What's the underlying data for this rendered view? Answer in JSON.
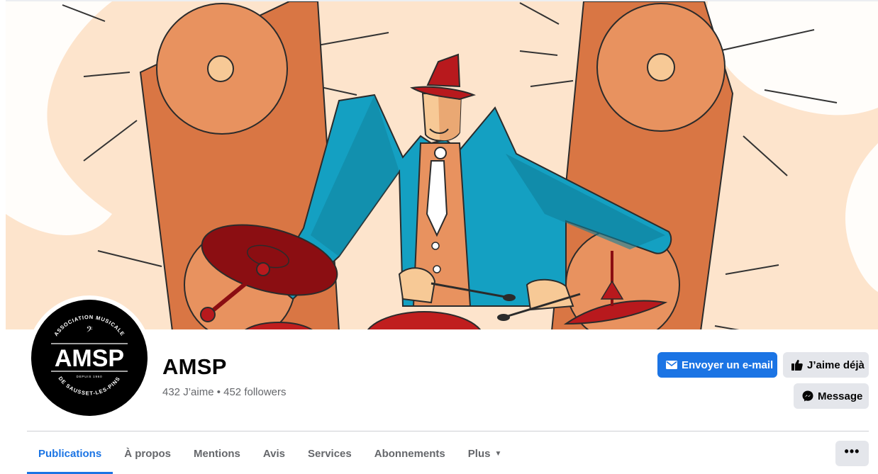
{
  "page": {
    "name": "AMSP",
    "stats": "432 J’aime • 452 followers",
    "avatar_text": {
      "arc_top": "ASSOCIATION MUSICALE",
      "center": "AMSP",
      "small": "DEPUIS 1960",
      "arc_bottom": "DE SAUSSET-LES-PINS"
    }
  },
  "actions": {
    "email_label": "Envoyer un e-mail",
    "like_label": "J’aime déjà",
    "message_label": "Message",
    "more_label": "•••"
  },
  "tabs": [
    {
      "label": "Publications",
      "active": true
    },
    {
      "label": "À propos"
    },
    {
      "label": "Mentions"
    },
    {
      "label": "Avis"
    },
    {
      "label": "Services"
    },
    {
      "label": "Abonnements"
    },
    {
      "label": "Plus"
    }
  ],
  "colors": {
    "accent": "#1b74e4",
    "button_grey": "#e4e6eb",
    "secondary_text": "#65676b",
    "cover_background": "#fde4cc",
    "speaker_orange": "#d97644",
    "suit_blue": "#14a0c2",
    "drum_red": "#c01e1e"
  },
  "icons": {
    "email": "envelope-icon",
    "like": "thumbs-up-icon",
    "message": "messenger-icon",
    "plus_caret": "caret-down-icon"
  }
}
